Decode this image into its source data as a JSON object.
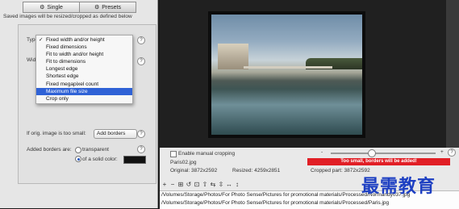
{
  "tabs": [
    {
      "label": "Single",
      "icon": "gear-icon"
    },
    {
      "label": "Presets",
      "icon": "gear-icon"
    }
  ],
  "info_text": "Saved images will be resized/cropped as defined below",
  "type_label": "Type",
  "width_label": "Widt",
  "dropdown": {
    "items": [
      {
        "label": "Fixed width and/or height",
        "checked": true
      },
      {
        "label": "Fixed dimensions"
      },
      {
        "label": "Fit to width and/or height"
      },
      {
        "label": "Fit to dimensions"
      },
      {
        "label": "Longest edge"
      },
      {
        "label": "Shortest edge"
      },
      {
        "label": "Fixed megapixel count"
      },
      {
        "label": "Maximum file size",
        "selected": true
      },
      {
        "label": "Crop only"
      }
    ]
  },
  "small_label": "If orig. image is too small:",
  "small_value": "Add borders",
  "borders_label": "Added borders are:",
  "radio_transparent": "transparent",
  "radio_solid": "of a solid color:",
  "help_glyph": "?",
  "manual_crop_label": "Enable manual cropping",
  "file_name": "Paris02.jpg",
  "original_label": "Original: 3872x2592",
  "resized_label": "Resized: 4259x2851",
  "cropped_label": "Cropped part: 3872x2592",
  "warning": "Too small, borders will be added!",
  "slider_minus": "-",
  "slider_plus": "+",
  "toolbar_icons": [
    "+",
    "−",
    "⊞",
    "↺",
    "⊡",
    "⇧",
    "⇆",
    "⇳",
    "↔",
    "↕"
  ],
  "paths": [
    "/Volumes/Storage/Photos/For Photo Sense/Pictures for promotional materials/Processed/Normandy037.jpg",
    "/Volumes/Storage/Photos/For Photo Sense/Pictures for promotional materials/Processed/Paris.jpg"
  ],
  "watermark": "最需教育",
  "colors": {
    "selection": "#2f62d6",
    "warning": "#e11f26",
    "watermark": "#1d3fc2"
  }
}
